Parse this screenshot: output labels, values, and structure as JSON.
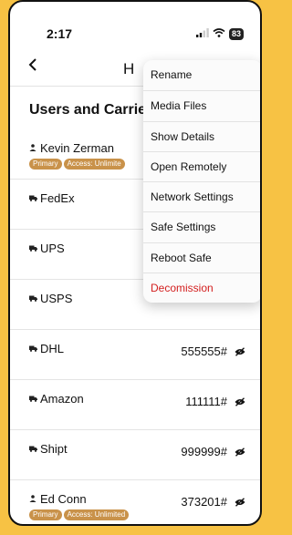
{
  "status_bar": {
    "time": "2:17",
    "battery": "83",
    "signal_icon": "signal-bars-icon",
    "wifi_icon": "wifi-icon"
  },
  "nav": {
    "back_icon": "chevron-left-icon",
    "title_fragment": "H"
  },
  "section": {
    "title": "Users and Carrie"
  },
  "rows": [
    {
      "type": "user",
      "label": "Kevin Zerman",
      "code": "",
      "badges": [
        "Primary",
        "Access: Unlimite"
      ]
    },
    {
      "type": "carrier",
      "label": "FedEx",
      "code": ""
    },
    {
      "type": "carrier",
      "label": "UPS",
      "code": ""
    },
    {
      "type": "carrier",
      "label": "USPS",
      "code": ""
    },
    {
      "type": "carrier",
      "label": "DHL",
      "code": "555555#"
    },
    {
      "type": "carrier",
      "label": "Amazon",
      "code": "111111#"
    },
    {
      "type": "carrier",
      "label": "Shipt",
      "code": "999999#"
    },
    {
      "type": "user",
      "label": "Ed Conn",
      "code": "373201#",
      "badges": [
        "Primary",
        "Access: Unlimited"
      ]
    }
  ],
  "menu": {
    "items": [
      {
        "label": "Rename",
        "danger": false
      },
      {
        "label": "Media Files",
        "danger": false
      },
      {
        "label": "Show Details",
        "danger": false
      },
      {
        "label": "Open Remotely",
        "danger": false
      },
      {
        "label": "Network Settings",
        "danger": false
      },
      {
        "label": "Safe Settings",
        "danger": false
      },
      {
        "label": "Reboot Safe",
        "danger": false
      },
      {
        "label": "Decomission",
        "danger": true
      }
    ]
  },
  "colors": {
    "background": "#f7c244",
    "badge": "#c9924a",
    "danger": "#d32020"
  }
}
